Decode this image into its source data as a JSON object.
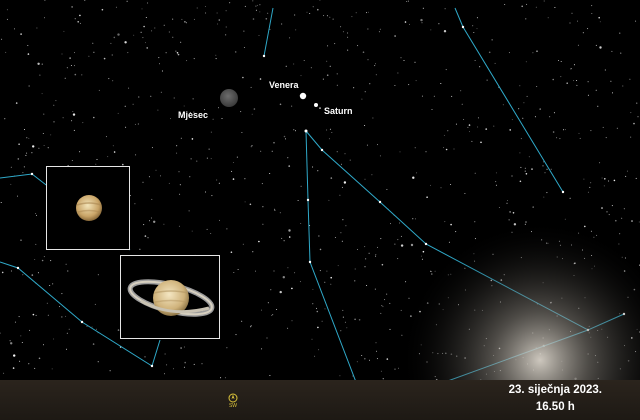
{
  "labels": {
    "venus": "Venera",
    "saturn": "Saturn",
    "moon": "Mjesec"
  },
  "date": {
    "line1": "23. siječnja 2023.",
    "line2": "16.50 h"
  },
  "compass": {
    "direction": "SW",
    "icon": "compass-marker-icon"
  },
  "insets": {
    "venus_icon": "venus-planet-icon",
    "saturn_icon": "saturn-planet-icon"
  },
  "colors": {
    "sky": "#000000",
    "constellation_line": "#2fa9c9",
    "label_text": "#ffffff",
    "ground": "#241f18",
    "compass": "#d9c23a"
  }
}
